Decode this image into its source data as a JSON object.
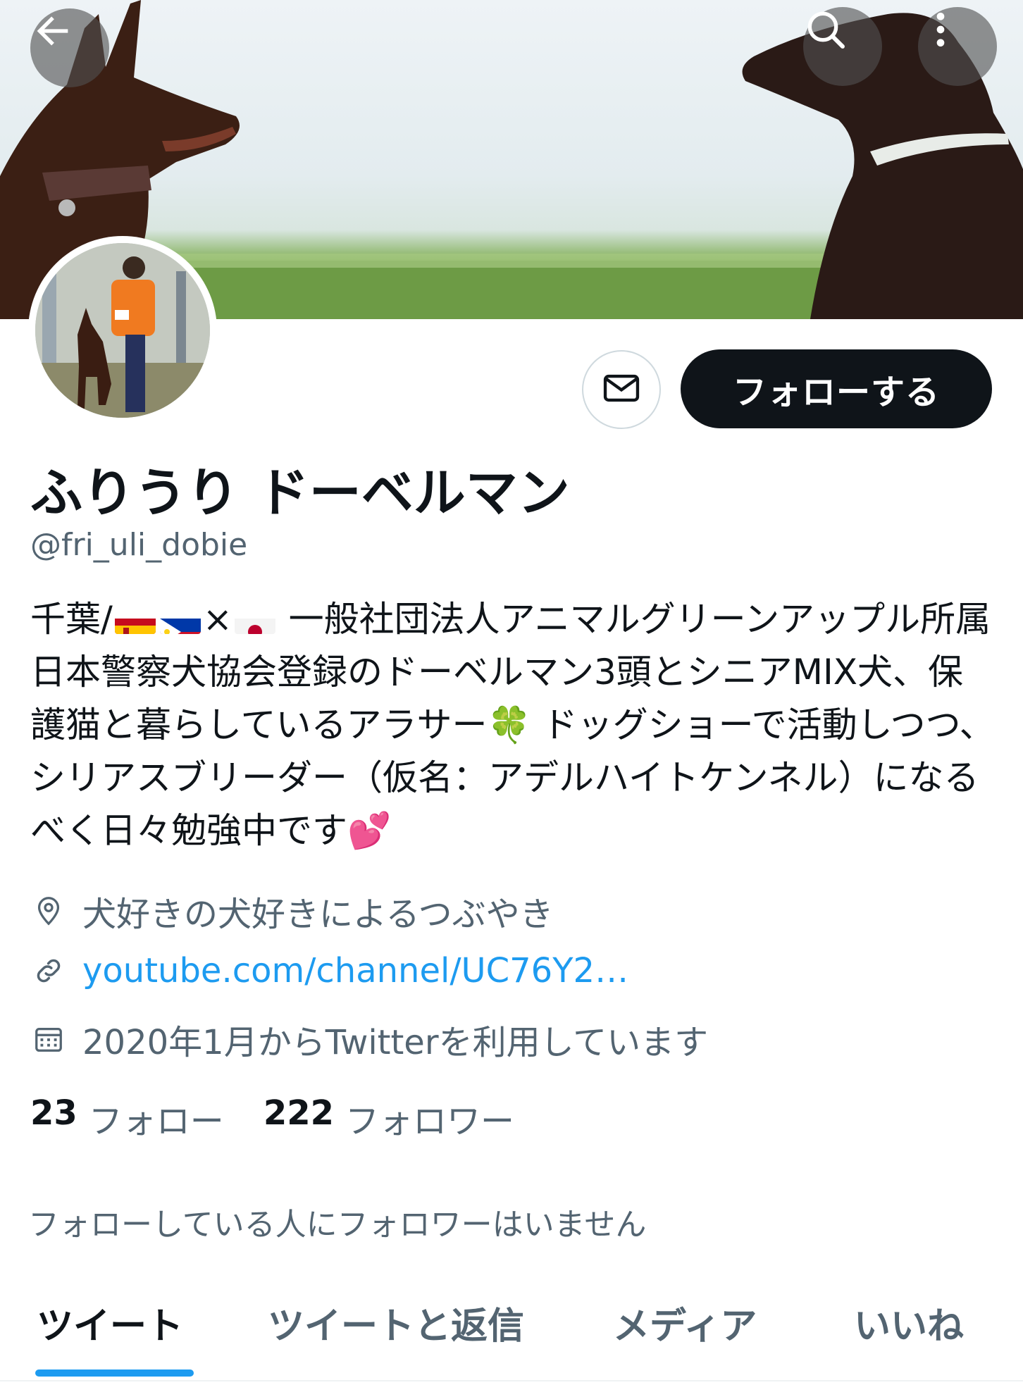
{
  "header": {
    "back_icon": "arrow-left-icon",
    "search_icon": "search-icon",
    "more_icon": "more-vertical-icon"
  },
  "actions": {
    "message_icon": "envelope-icon",
    "follow_label": "フォローする"
  },
  "profile": {
    "display_name": "ふりうり ドーベルマン",
    "handle": "@fri_uli_dobie",
    "bio": {
      "prefix": "千葉/",
      "flags": [
        "spain-flag",
        "philippines-flag",
        "japan-flag"
      ],
      "times": "×",
      "text_1": " 一般社団法人アニマルグリーンアップル所属 日本警察犬協会登録のドーベルマン3頭とシニアMIX犬、保護猫と暮らしているアラサー",
      "clover_emoji": "🍀",
      "text_2": " ドッグショーで活動しつつ、シリアスブリーダー（仮名：アデルハイトケンネル）になるべく日々勉強中です",
      "hearts_emoji": "💕"
    },
    "location": "犬好きの犬好きによるつぶやき",
    "website": "youtube.com/channel/UC76Y2…",
    "joined": "2020年1月からTwitterを利用しています"
  },
  "stats": {
    "following_count": "23",
    "following_label": "フォロー",
    "followers_count": "222",
    "followers_label": "フォロワー"
  },
  "mutuals_text": "フォローしている人にフォロワーはいません",
  "tabs": [
    {
      "label": "ツイート",
      "active": true
    },
    {
      "label": "ツイートと返信",
      "active": false
    },
    {
      "label": "メディア",
      "active": false
    },
    {
      "label": "いいね",
      "active": false
    }
  ],
  "colors": {
    "accent": "#1d9bf0",
    "text_primary": "#0f1419",
    "text_secondary": "#536471",
    "follow_button_bg": "#0f1419"
  }
}
